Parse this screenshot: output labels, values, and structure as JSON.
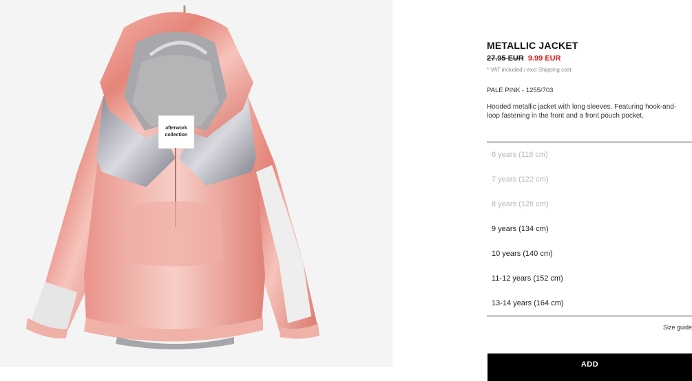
{
  "product": {
    "name": "METALLIC JACKET",
    "old_price": "27.95 EUR",
    "price": "9.99 EUR",
    "vat_note": "* VAT included / excl Shipping cost",
    "color_ref": "PALE PINK - 1255/703",
    "description": "Hooded metallic jacket with long sleeves. Featuring hook-and-loop fastening in the front and a front pouch pocket.",
    "label_lines": [
      "afterwork",
      "collection"
    ]
  },
  "sizes": [
    {
      "label": "6 years (116 cm)",
      "available": false
    },
    {
      "label": "7 years (122 cm)",
      "available": false
    },
    {
      "label": "8 years (128 cm)",
      "available": false
    },
    {
      "label": "9 years (134 cm)",
      "available": true
    },
    {
      "label": "10 years (140 cm)",
      "available": true
    },
    {
      "label": "11-12 years (152 cm)",
      "available": true
    },
    {
      "label": "13-14 years (164 cm)",
      "available": true
    }
  ],
  "actions": {
    "size_guide": "Size guide",
    "add": "ADD"
  },
  "colors": {
    "sale_price": "#e01a1a",
    "unavailable_size": "#b5b5b5",
    "button_bg": "#000000"
  }
}
